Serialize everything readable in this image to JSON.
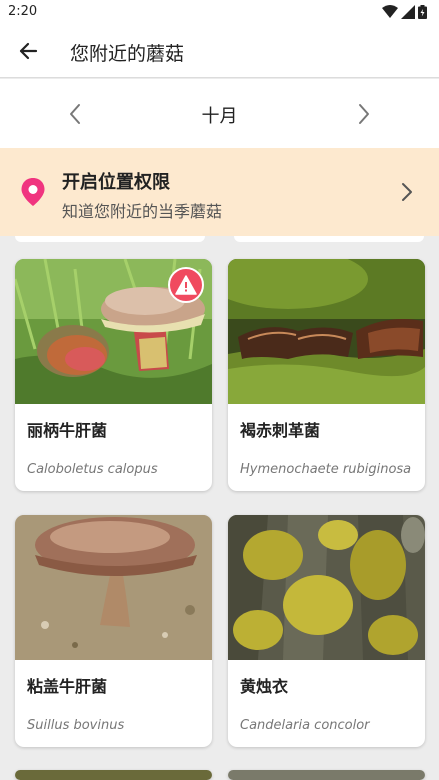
{
  "status": {
    "time": "2:20",
    "icons": [
      "wifi-icon",
      "signal-icon",
      "battery-icon"
    ]
  },
  "app_bar": {
    "back_icon": "arrow-left-icon",
    "title": "您附近的蘑菇"
  },
  "month_nav": {
    "label": "十月",
    "prev_icon": "chevron-left-icon",
    "next_icon": "chevron-right-icon"
  },
  "location_banner": {
    "title": "开启位置权限",
    "subtitle": "知道您附近的当季蘑菇",
    "icon": "location-pin-icon",
    "accent_color": "#f0347f",
    "background_color": "#fde9cf"
  },
  "mushrooms": [
    {
      "name": "丽柄牛肝菌",
      "scientific": "Caloboletus calopus",
      "warning": true,
      "image": "mushroom-photo"
    },
    {
      "name": "褐赤刺革菌",
      "scientific": "Hymenochaete rubiginosa",
      "warning": false,
      "image": "bracket-fungus-photo"
    },
    {
      "name": "粘盖牛肝菌",
      "scientific": "Suillus bovinus",
      "warning": false,
      "image": "mushroom-photo"
    },
    {
      "name": "黄烛衣",
      "scientific": "Candelaria concolor",
      "warning": false,
      "image": "lichen-photo"
    }
  ],
  "colors": {
    "warning_badge": "#f04a5f",
    "page_background": "#ececec"
  }
}
